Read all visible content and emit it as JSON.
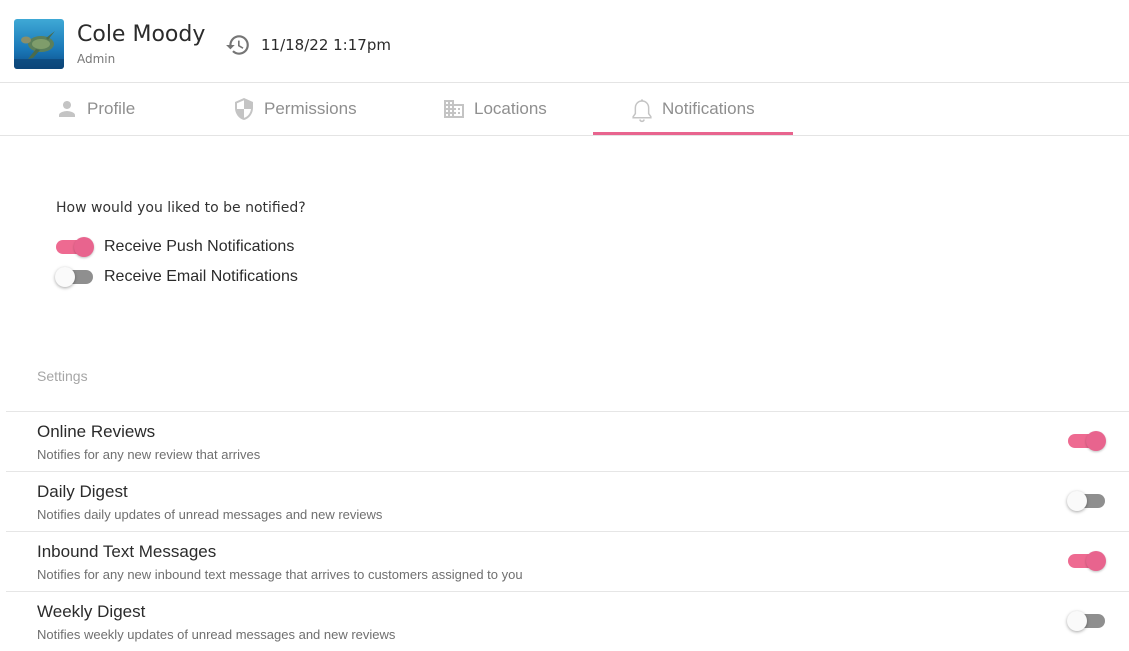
{
  "header": {
    "user_name": "Cole Moody",
    "user_role": "Admin",
    "timestamp": "11/18/22 1:17pm"
  },
  "tabs": [
    {
      "label": "Profile",
      "icon": "person-icon",
      "active": false
    },
    {
      "label": "Permissions",
      "icon": "shield-icon",
      "active": false
    },
    {
      "label": "Locations",
      "icon": "building-icon",
      "active": false
    },
    {
      "label": "Notifications",
      "icon": "bell-icon",
      "active": true
    }
  ],
  "notify": {
    "question": "How would you liked to be notified?",
    "options": [
      {
        "label": "Receive Push Notifications",
        "enabled": true
      },
      {
        "label": "Receive Email Notifications",
        "enabled": false
      }
    ]
  },
  "settings": {
    "heading": "Settings",
    "items": [
      {
        "title": "Online Reviews",
        "description": "Notifies for any new review that arrives",
        "enabled": true
      },
      {
        "title": "Daily Digest",
        "description": "Notifies daily updates of unread messages and new reviews",
        "enabled": false
      },
      {
        "title": "Inbound Text Messages",
        "description": "Notifies for any new inbound text message that arrives to customers assigned to you",
        "enabled": true
      },
      {
        "title": "Weekly Digest",
        "description": "Notifies weekly updates of unread messages and new reviews",
        "enabled": false
      }
    ]
  },
  "colors": {
    "accent": "#e8648e",
    "toggle_off": "#8f8f8f",
    "tab_text": "#8f8f8f"
  }
}
